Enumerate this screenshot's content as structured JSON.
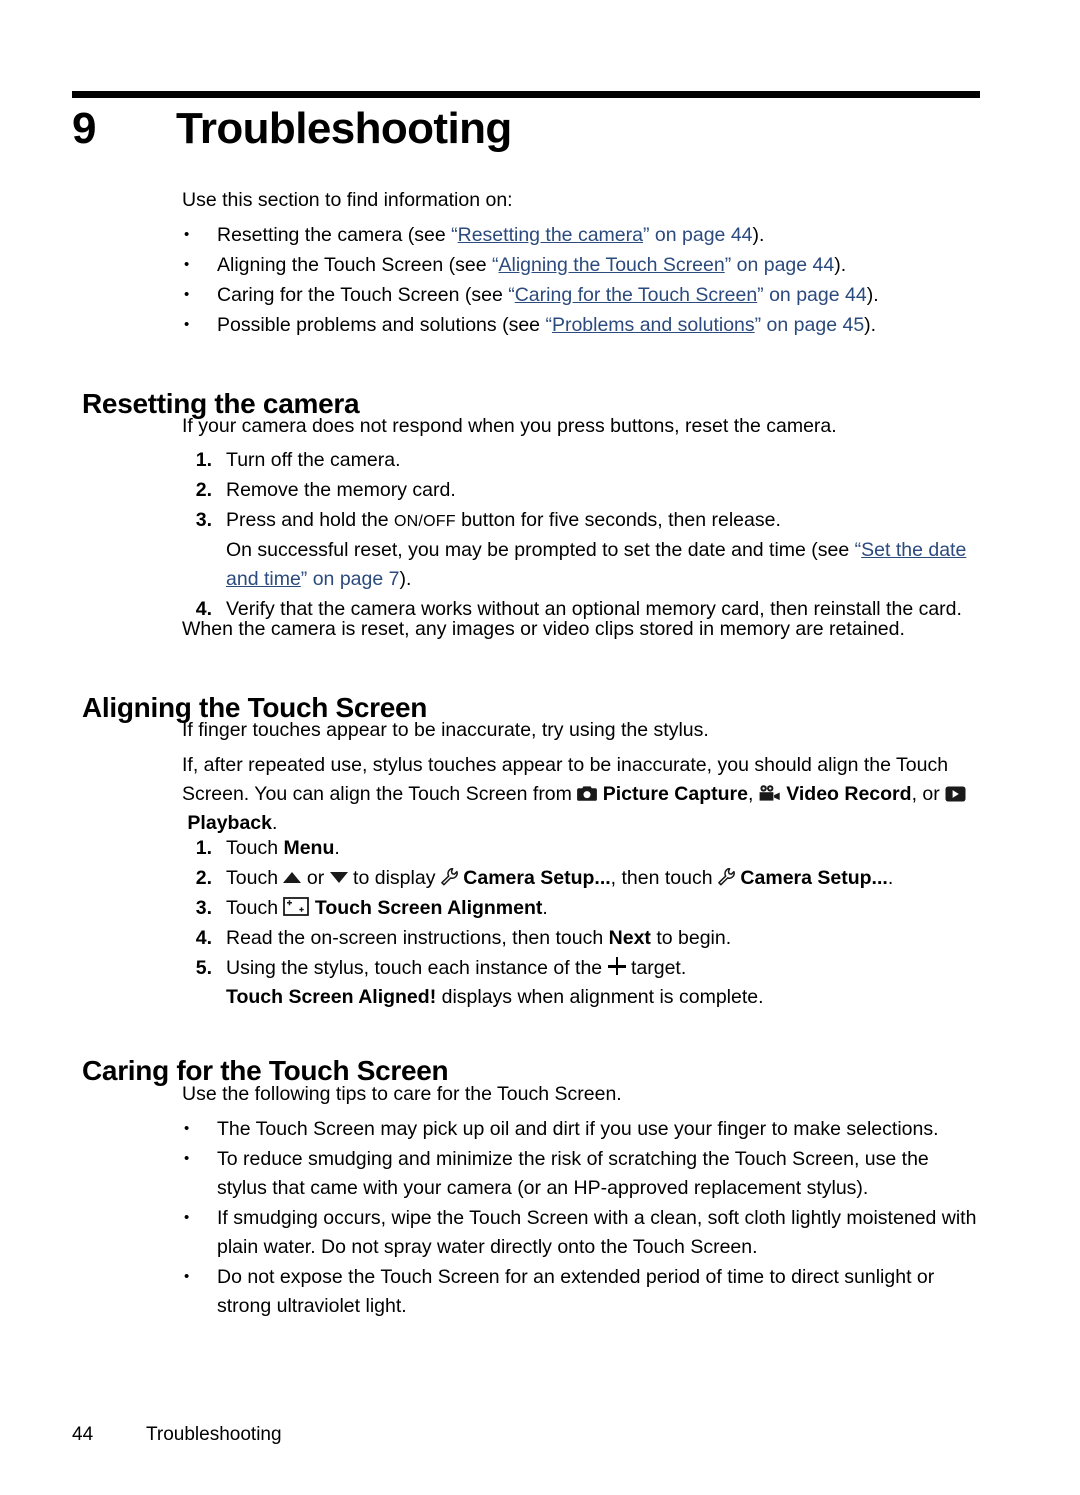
{
  "chapter": {
    "number": "9",
    "title": "Troubleshooting"
  },
  "intro": {
    "lead": "Use this section to find information on:",
    "bullets": [
      {
        "pre": "Resetting the camera (see ",
        "link": "Resetting the camera",
        "mid": " on page ",
        "page": "44",
        "post": ")."
      },
      {
        "pre": "Aligning the Touch Screen (see ",
        "link": "Aligning the Touch Screen",
        "mid": " on page ",
        "page": "44",
        "post": ")."
      },
      {
        "pre": "Caring for the Touch Screen (see ",
        "link": "Caring for the Touch Screen",
        "mid": " on page ",
        "page": "44",
        "post": ")."
      },
      {
        "pre": "Possible problems and solutions (see ",
        "link": "Problems and solutions",
        "mid": " on page ",
        "page": "45",
        "post": ")."
      }
    ]
  },
  "resetting": {
    "heading": "Resetting the camera",
    "intro": "If your camera does not respond when you press buttons, reset the camera.",
    "step1_num": "1.",
    "step1": "Turn off the camera.",
    "step2_num": "2.",
    "step2": "Remove the memory card.",
    "step3_num": "3.",
    "step3_a": "Press and hold the ",
    "step3_onoff": "ON/OFF",
    "step3_b": " button for five seconds, then release.",
    "step3_sub_a": "On successful reset, you may be prompted to set the date and time (see ",
    "step3_sub_link": "Set the date and time",
    "step3_sub_mid": " on page ",
    "step3_sub_page": "7",
    "step3_sub_post": ").",
    "step4_num": "4.",
    "step4": "Verify that the camera works without an optional memory card, then reinstall the card.",
    "closing": "When the camera is reset, any images or video clips stored in memory are retained."
  },
  "aligning": {
    "heading": "Aligning the Touch Screen",
    "para1": "If finger touches appear to be inaccurate, try using the stylus.",
    "para2_a": "If, after repeated use, stylus touches appear to be inaccurate, you should align the Touch Screen. You can align the Touch Screen from ",
    "picture_capture": "Picture Capture",
    "para2_b": ", ",
    "video_record": "Video Record",
    "para2_c": ", or ",
    "playback": "Playback",
    "para2_d": ".",
    "step1_num": "1.",
    "step1_a": "Touch ",
    "step1_menu": "Menu",
    "step1_b": ".",
    "step2_num": "2.",
    "step2_a": "Touch ",
    "step2_b": " or ",
    "step2_c": " to display ",
    "step2_setup1": "Camera Setup...",
    "step2_d": ", then touch ",
    "step2_setup2": "Camera Setup...",
    "step2_e": ".",
    "step3_num": "3.",
    "step3_a": "Touch ",
    "step3_label": "Touch Screen Alignment",
    "step3_b": ".",
    "step4_num": "4.",
    "step4_a": "Read the on-screen instructions, then touch ",
    "step4_next": "Next",
    "step4_b": " to begin.",
    "step5_num": "5.",
    "step5_a": "Using the stylus, touch each instance of the ",
    "step5_b": " target.",
    "step5_sub_bold": "Touch Screen Aligned!",
    "step5_sub_rest": " displays when alignment is complete."
  },
  "caring": {
    "heading": "Caring for the Touch Screen",
    "intro": "Use the following tips to care for the Touch Screen.",
    "bullets": [
      "The Touch Screen may pick up oil and dirt if you use your finger to make selections.",
      "To reduce smudging and minimize the risk of scratching the Touch Screen, use the stylus that came with your camera (or an HP-approved replacement stylus).",
      "If smudging occurs, wipe the Touch Screen with a clean, soft cloth lightly moistened with plain water. Do not spray water directly onto the Touch Screen.",
      "Do not expose the Touch Screen for an extended period of time to direct sunlight or strong ultraviolet light."
    ]
  },
  "footer": {
    "page_number": "44",
    "section": "Troubleshooting"
  },
  "colors": {
    "link": "#2b4a7d",
    "text": "#000000",
    "rule": "#000000"
  }
}
